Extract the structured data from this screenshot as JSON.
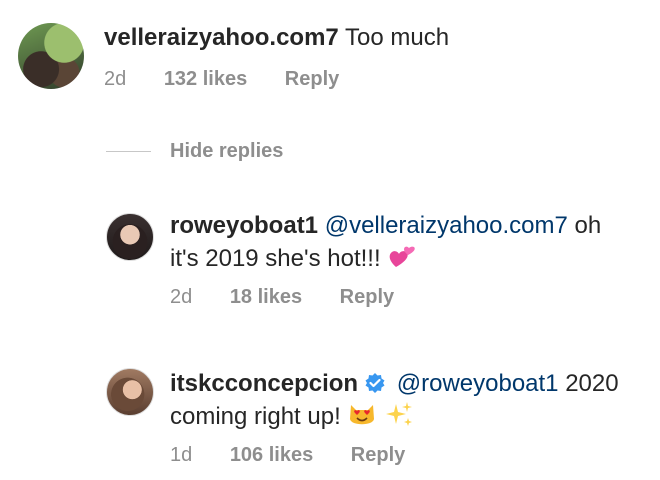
{
  "comments": [
    {
      "username": "velleraizyahoo.com7",
      "text": "Too much",
      "time": "2d",
      "likes": "132 likes",
      "reply": "Reply"
    },
    {
      "username": "roweyoboat1",
      "mention": "@velleraizyahoo.com7",
      "text_line1": "oh",
      "text_line2": "it's 2019 she's hot!!!",
      "emoji": "two-hearts",
      "time": "2d",
      "likes": "18 likes",
      "reply": "Reply"
    },
    {
      "username": "itskcconcepcion",
      "verified": true,
      "mention": "@roweyoboat1",
      "text_line1": "2020",
      "text_line2": "coming right up!",
      "emojis": [
        "heart-eyes-cat",
        "sparkles"
      ],
      "time": "1d",
      "likes": "106 likes",
      "reply": "Reply"
    }
  ],
  "hide_replies": "Hide replies",
  "colors": {
    "text": "#262626",
    "meta": "#8e8e8e",
    "mention": "#00376b",
    "verified": "#3897f0"
  }
}
